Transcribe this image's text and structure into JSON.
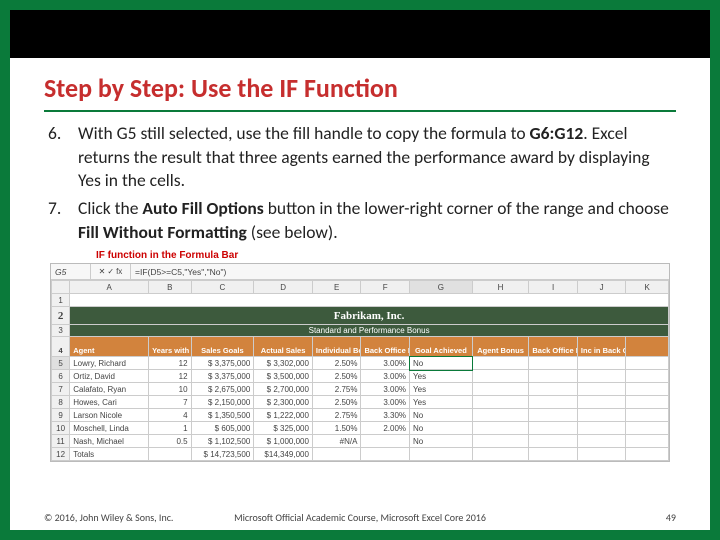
{
  "title": "Step by Step: Use the IF Function",
  "steps": {
    "s6": {
      "num": "6.",
      "t1": "With G5 still selected, use the fill handle to copy the formula to ",
      "t2": "G6:G12",
      "t3": ". Excel returns the result that three agents earned the performance award by displaying Yes in the cells."
    },
    "s7": {
      "num": "7.",
      "t1": "Click the ",
      "t2": "Auto Fill Options",
      "t3": " button in the lower-right corner of the range and choose ",
      "t4": "Fill Without Formatting",
      "t5": " (see below)."
    }
  },
  "figcaption": "IF function in the Formula Bar",
  "namebox": "G5",
  "fxsym": {
    "x": "✕",
    "c": "✓",
    "f": "fx"
  },
  "formula": "=IF(D5>=C5,\"Yes\",\"No\")",
  "cols": [
    "A",
    "B",
    "C",
    "D",
    "E",
    "F",
    "G",
    "H",
    "I",
    "J",
    "K"
  ],
  "company": "Fabrikam, Inc.",
  "subtitle": "Standard and Performance Bonus",
  "hdr": {
    "A": "Agent",
    "B": "Years with Fabrikam",
    "C": "Sales Goals",
    "D": "Actual Sales",
    "E": "Individual Bonus Rate",
    "F": "Back Office Bonus Rate",
    "G": "Goal Achieved",
    "H": "Agent Bonus",
    "I": "Back Office Bonus",
    "J": "Inc in Back Office",
    "K": ""
  },
  "rows": [
    {
      "r": "5",
      "A": "Lowry, Richard",
      "B": "12",
      "C": "$ 3,375,000",
      "D": "$ 3,302,000",
      "E": "2.50%",
      "F": "3.00%",
      "G": "No",
      "H": "",
      "I": "",
      "J": ""
    },
    {
      "r": "6",
      "A": "Ortiz, David",
      "B": "12",
      "C": "$ 3,375,000",
      "D": "$ 3,500,000",
      "E": "2.50%",
      "F": "3.00%",
      "G": "Yes",
      "H": "",
      "I": "",
      "J": ""
    },
    {
      "r": "7",
      "A": "Calafato, Ryan",
      "B": "10",
      "C": "$ 2,675,000",
      "D": "$ 2,700,000",
      "E": "2.75%",
      "F": "3.00%",
      "G": "Yes",
      "H": "",
      "I": "",
      "J": ""
    },
    {
      "r": "8",
      "A": "Howes, Cari",
      "B": "7",
      "C": "$ 2,150,000",
      "D": "$ 2,300,000",
      "E": "2.50%",
      "F": "3.00%",
      "G": "Yes",
      "H": "",
      "I": "",
      "J": ""
    },
    {
      "r": "9",
      "A": "Larson Nicole",
      "B": "4",
      "C": "$ 1,350,500",
      "D": "$ 1,222,000",
      "E": "2.75%",
      "F": "3.30%",
      "G": "No",
      "H": "",
      "I": "",
      "J": ""
    },
    {
      "r": "10",
      "A": "Moschell, Linda",
      "B": "1",
      "C": "$    605,000",
      "D": "$    325,000",
      "E": "1.50%",
      "F": "2.00%",
      "G": "No",
      "H": "",
      "I": "",
      "J": ""
    },
    {
      "r": "11",
      "A": "Nash, Michael",
      "B": "0.5",
      "C": "$ 1,102,500",
      "D": "$ 1,000,000",
      "E": "#N/A",
      "F": "",
      "G": "No",
      "H": "",
      "I": "",
      "J": ""
    },
    {
      "r": "12",
      "A": "Totals",
      "B": "",
      "C": "$ 14,723,500",
      "D": "$14,349,000",
      "E": "",
      "F": "",
      "G": "",
      "H": "",
      "I": "",
      "J": ""
    }
  ],
  "footer": {
    "left": "© 2016, John Wiley & Sons, Inc.",
    "mid": "Microsoft Official Academic Course, Microsoft Excel Core 2016",
    "page": "49"
  }
}
